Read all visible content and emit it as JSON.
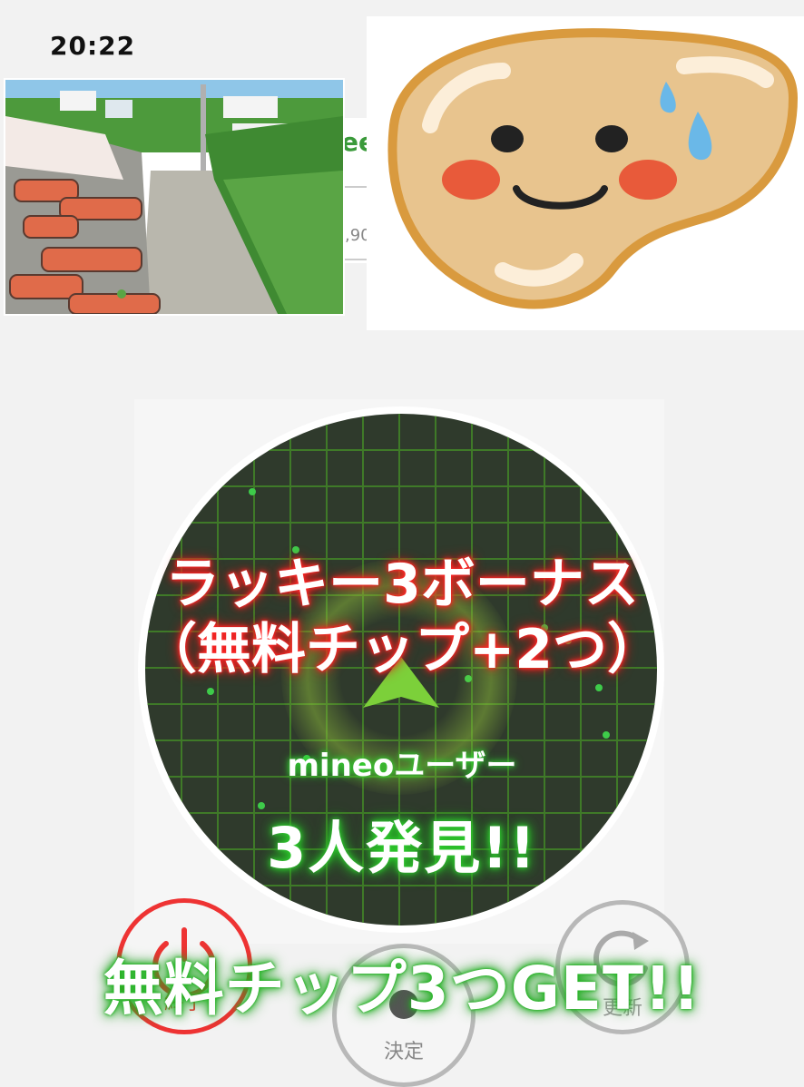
{
  "status_bar": {
    "time": "20:22"
  },
  "background_app": {
    "partial_title": "ee",
    "partial_value": ",90"
  },
  "stickers": {
    "photo": {
      "subject": "okinawa-stone-path-illustration"
    },
    "mascot": {
      "subject": "liver-character-sweating"
    }
  },
  "radar": {
    "lucky_bonus_line1": "ラッキー3ボーナス",
    "lucky_bonus_line2": "（無料チップ+2つ）",
    "user_label": "mineoユーザー",
    "found_count_label": "3人発見!!"
  },
  "controls": {
    "end_label": "終了",
    "decide_label": "決定",
    "refresh_label": "更新"
  },
  "reward_banner": "無料チップ3つGET!!",
  "colors": {
    "radar_bg": "#2f3a2c",
    "radar_grid": "#3f7a28",
    "lucky_glow": "#ff2a2a",
    "green_glow": "#2fd02f",
    "end_red": "#e33333"
  }
}
